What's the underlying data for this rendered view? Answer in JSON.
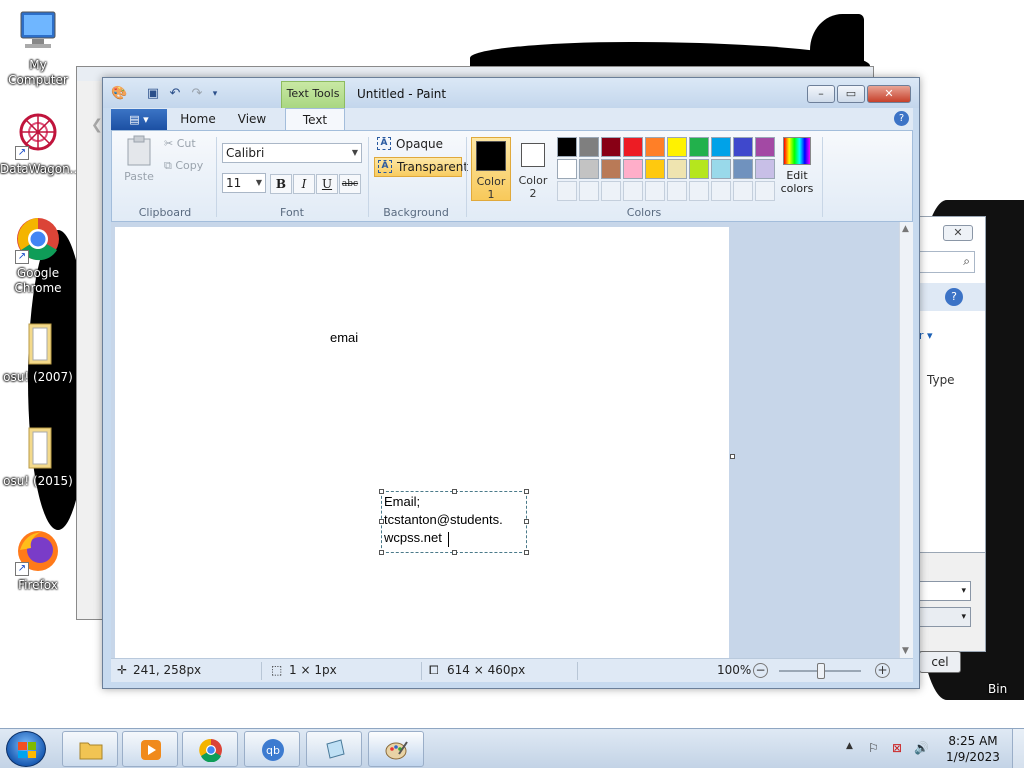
{
  "desktop": {
    "icons": [
      {
        "label": "My Computer"
      },
      {
        "label": "DataWagon..."
      },
      {
        "label": "Google Chrome"
      },
      {
        "label": "osu! (2007)"
      },
      {
        "label": "osu! (2015)"
      },
      {
        "label": "Firefox"
      }
    ],
    "recycle_bin_label": "Bin"
  },
  "right_dialog": {
    "type_label": "Type",
    "cancel_label": "cel"
  },
  "paint": {
    "title": "Untitled - Paint",
    "context_tab": "Text Tools",
    "tabs": [
      "Home",
      "View",
      "Text"
    ],
    "clipboard": {
      "paste": "Paste",
      "cut": "Cut",
      "copy": "Copy",
      "group": "Clipboard"
    },
    "font": {
      "family": "Calibri",
      "size": "11",
      "bold": "B",
      "italic": "I",
      "underline": "U",
      "strike": "abc",
      "group": "Font"
    },
    "background": {
      "opaque": "Opaque",
      "transparent": "Transparent",
      "group": "Background"
    },
    "colors": {
      "color1_label": "Color 1",
      "color2_label": "Color 2",
      "edit_label": "Edit colors",
      "group": "Colors",
      "color1": "#000000",
      "color2": "#ffffff",
      "row1": [
        "#000000",
        "#7f7f7f",
        "#880015",
        "#ed1c24",
        "#ff7f27",
        "#fff200",
        "#22b14c",
        "#00a2e8",
        "#3f48cc",
        "#a349a4"
      ],
      "row2": [
        "#ffffff",
        "#c3c3c3",
        "#b97a57",
        "#ffaec9",
        "#ffc90e",
        "#efe4b0",
        "#b5e61d",
        "#99d9ea",
        "#7092be",
        "#c8bfe7"
      ]
    },
    "canvas": {
      "stray_text": "emai",
      "textbox_lines": [
        "Email;",
        "tcstanton@students.",
        "wcpss.net"
      ]
    },
    "status": {
      "cursor_pos": "241, 258px",
      "selection_size": "1 × 1px",
      "image_size": "614 × 460px",
      "zoom": "100%"
    }
  },
  "taskbar": {
    "time": "8:25 AM",
    "date": "1/9/2023"
  }
}
